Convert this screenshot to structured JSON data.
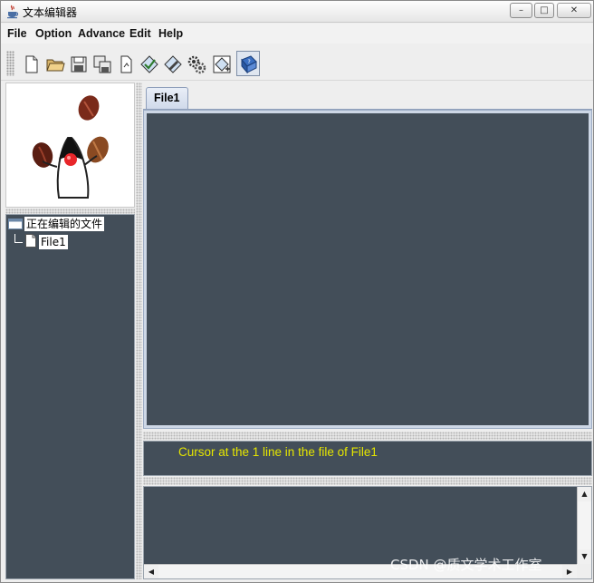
{
  "window": {
    "title": "文本编辑器",
    "controls": {
      "minimize": "–",
      "maximize": "□",
      "close": "✕"
    }
  },
  "menu": [
    "File",
    "Option",
    "Advance",
    "Edit",
    "Help"
  ],
  "toolbar": {
    "icons": [
      "new-file-icon",
      "open-folder-icon",
      "save-icon",
      "save-all-icon",
      "page-icon",
      "check-icon",
      "edit-icon",
      "gears-icon",
      "add-icon",
      "help-book-icon"
    ]
  },
  "tree": {
    "root_label": "正在编辑的文件",
    "items": [
      {
        "label": "File1"
      }
    ]
  },
  "tabs": [
    {
      "label": "File1",
      "active": true
    }
  ],
  "status": {
    "message": "Cursor at the 1 line in the file of File1"
  },
  "scrollbars": {
    "up": "▲",
    "down": "▼",
    "left": "◀",
    "right": "▶"
  },
  "watermark": "CSDN @质文学术工作室",
  "colors": {
    "panel_bg": "#434e59",
    "status_text": "#e6e600",
    "tab_border": "#8f9fbb"
  }
}
